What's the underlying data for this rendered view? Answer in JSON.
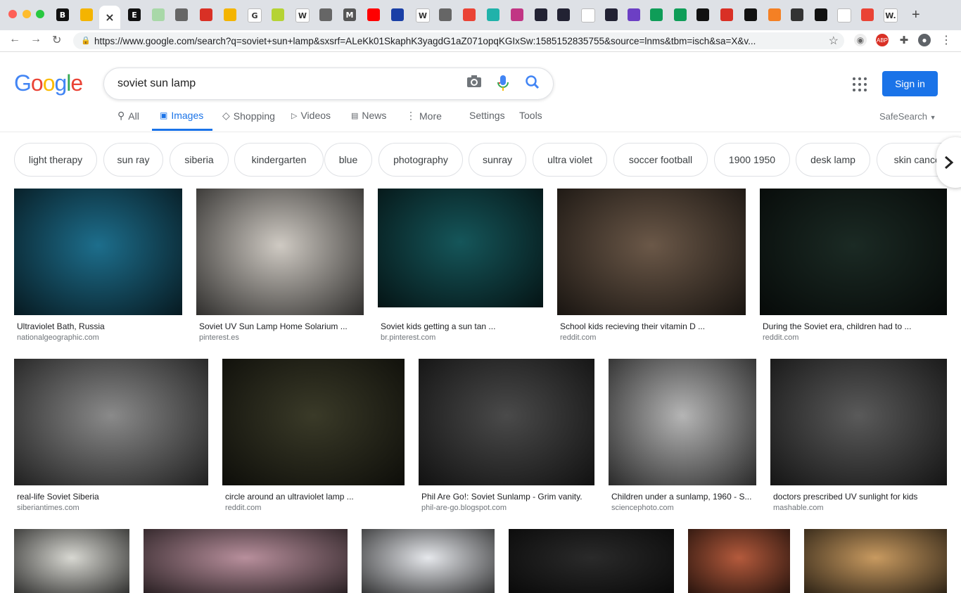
{
  "browser": {
    "url": "https://www.google.com/search?q=soviet+sun+lamp&sxsrf=ALeKk01SkaphK3yagdG1aZ071opqKGIxSw:1585152835755&source=lnms&tbm=isch&sa=X&v...",
    "tab_labels": [
      "B",
      "",
      "",
      "E",
      "",
      "",
      "",
      "",
      "G",
      "",
      "W",
      "",
      "M",
      "",
      "",
      "W",
      "",
      "",
      "",
      "",
      "",
      "",
      "",
      "",
      "",
      "",
      "",
      "",
      "",
      "",
      "",
      "",
      "",
      "",
      "",
      "W."
    ]
  },
  "search": {
    "query": "soviet sun lamp"
  },
  "logo": {
    "letters": [
      "G",
      "o",
      "o",
      "g",
      "l",
      "e"
    ],
    "colors": [
      "#4285f4",
      "#ea4335",
      "#fbbc05",
      "#4285f4",
      "#34a853",
      "#ea4335"
    ]
  },
  "header": {
    "signin_label": "Sign in",
    "safesearch_label": "SafeSearch"
  },
  "nav_tabs": [
    {
      "label": "All"
    },
    {
      "label": "Images"
    },
    {
      "label": "Shopping"
    },
    {
      "label": "Videos"
    },
    {
      "label": "News"
    },
    {
      "label": "More"
    },
    {
      "label": "Settings"
    },
    {
      "label": "Tools"
    }
  ],
  "chips": [
    "light therapy",
    "sun ray",
    "siberia",
    "kindergarten",
    "blue",
    "photography",
    "sunray",
    "ultra violet",
    "soccer football",
    "1900 1950",
    "desk lamp",
    "skin cancer"
  ],
  "results_row1": [
    {
      "title": "Ultraviolet Bath, Russia",
      "source": "nationalgeographic.com"
    },
    {
      "title": "Soviet UV Sun Lamp Home Solarium ...",
      "source": "pinterest.es"
    },
    {
      "title": "Soviet kids getting a sun tan ...",
      "source": "br.pinterest.com"
    },
    {
      "title": "School kids recieving their vitamin D ...",
      "source": "reddit.com"
    },
    {
      "title": "During the Soviet era, children had to ...",
      "source": "reddit.com"
    }
  ],
  "results_row2": [
    {
      "title": "real-life Soviet Siberia",
      "source": "siberiantimes.com"
    },
    {
      "title": "circle around an ultraviolet lamp ...",
      "source": "reddit.com"
    },
    {
      "title": "Phil Are Go!: Soviet Sunlamp - Grim vanity.",
      "source": "phil-are-go.blogspot.com"
    },
    {
      "title": "Children under a sunlamp, 1960 - S...",
      "source": "sciencephoto.com"
    },
    {
      "title": "doctors prescribed UV sunlight for kids",
      "source": "mashable.com"
    }
  ],
  "thumb_colors": {
    "row1": [
      "#1d6e8c",
      "#cfcac3",
      "#15565a",
      "#6b5848",
      "#1b2a24"
    ],
    "row2": [
      "#8a8a8a",
      "#3a3a28",
      "#4a4a4a",
      "#b5b5b5",
      "#5a5a5a"
    ],
    "row3": [
      "#d8d8d2",
      "#b88f9c",
      "#e6e8ec",
      "#2a2a2a",
      "#b45a3c",
      "#c89a60"
    ]
  }
}
